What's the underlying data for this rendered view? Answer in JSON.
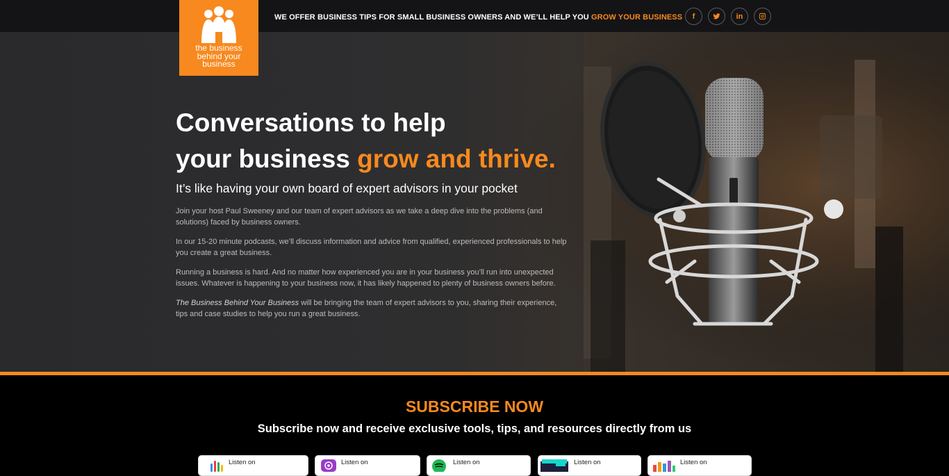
{
  "topbar": {
    "message_prefix": "WE OFFER BUSINESS TIPS FOR SMALL BUSINESS OWNERS AND WE’LL HELP YOU ",
    "message_highlight": "GROW YOUR BUSINESS",
    "socials": [
      {
        "icon": "facebook-icon",
        "glyph": "f"
      },
      {
        "icon": "twitter-icon"
      },
      {
        "icon": "linkedin-icon",
        "glyph": "in"
      },
      {
        "icon": "instagram-icon"
      }
    ]
  },
  "logo": {
    "line1": "the business",
    "line2": "behind your",
    "line3": "business"
  },
  "hero": {
    "heading_line1": "Conversations to help",
    "heading_line2_plain": "your business ",
    "heading_line2_accent": "grow and thrive.",
    "tagline": "It’s like having your own board of expert advisors in your pocket",
    "paragraphs": [
      "Join your host Paul Sweeney and our team of expert advisors as we take a deep dive into the problems (and solutions) faced by business owners.",
      "In our 15-20 minute podcasts, we’ll discuss information and advice from qualified, experienced professionals to help you create a great business.",
      "Running a business is hard. And no matter how experienced you are in your business you’ll run into unexpected issues. Whatever is happening to your business now, it has likely happened to plenty of business owners before."
    ],
    "last_paragraph_italic": "The Business Behind Your Business",
    "last_paragraph_rest": " will be bringing the team of expert advisors to you, sharing their experience, tips and case studies to help you run a great business."
  },
  "subscribe": {
    "title": "SUBSCRIBE NOW",
    "subtitle": "Subscribe now and receive exclusive tools, tips, and resources directly from us",
    "platforms": [
      {
        "label": "Listen on",
        "icon": "google-podcasts-icon"
      },
      {
        "label": "Listen on",
        "icon": "apple-podcasts-icon"
      },
      {
        "label": "Listen on",
        "icon": "spotify-icon"
      },
      {
        "label": "Listen on",
        "icon": "tunein-icon"
      },
      {
        "label": "Listen on",
        "icon": "podcast-bars-icon"
      }
    ]
  },
  "colors": {
    "accent": "#f7891f",
    "topbar": "#141416",
    "background": "#000000"
  }
}
